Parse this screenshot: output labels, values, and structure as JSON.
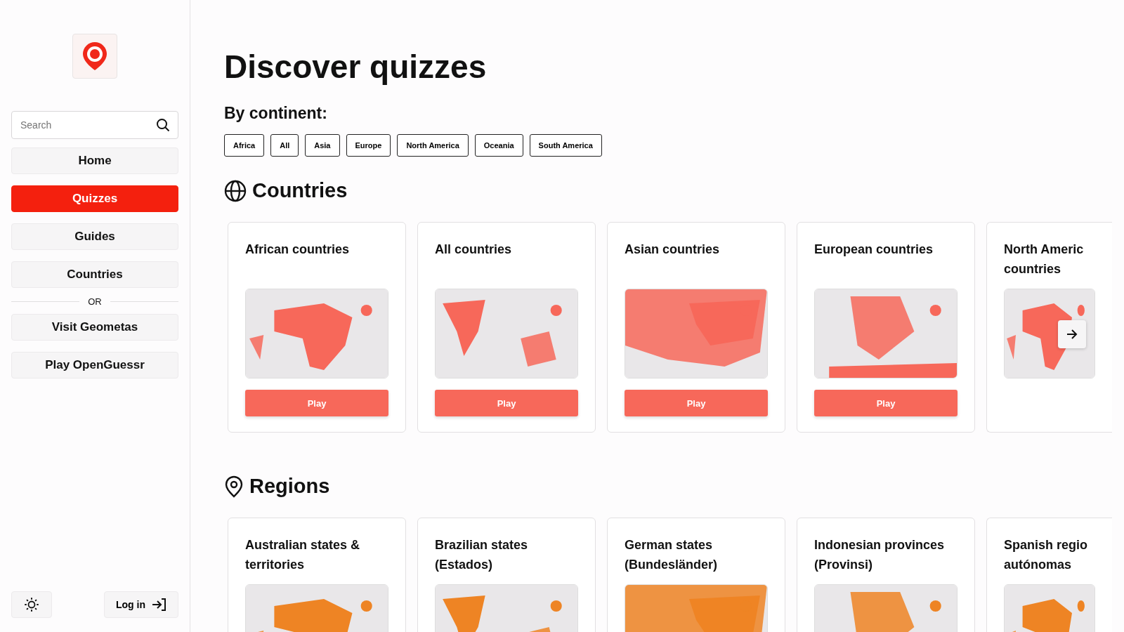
{
  "sidebar": {
    "search": {
      "placeholder": "Search"
    },
    "nav": [
      {
        "label": "Home",
        "selected": false
      },
      {
        "label": "Quizzes",
        "selected": true
      },
      {
        "label": "Guides",
        "selected": false
      },
      {
        "label": "Countries",
        "selected": false
      }
    ],
    "separator": "OR",
    "links": [
      "Visit Geometas",
      "Play OpenGuessr"
    ],
    "login": "Log in"
  },
  "title": "Discover quizzes",
  "filter_label": "By continent:",
  "filters": [
    "Africa",
    "All",
    "Asia",
    "Europe",
    "North America",
    "Oceania",
    "South America"
  ],
  "sections": [
    {
      "kind": "countries",
      "title": "Countries",
      "cards": [
        {
          "title": "African countries",
          "play": "Play"
        },
        {
          "title": "All countries",
          "play": "Play"
        },
        {
          "title": "Asian countries",
          "play": "Play"
        },
        {
          "title": "European countries",
          "play": "Play"
        },
        {
          "title": "North Americ countries",
          "partial": true
        }
      ]
    },
    {
      "kind": "regions",
      "title": "Regions",
      "cards": [
        {
          "title": "Australian states & territories"
        },
        {
          "title": "Brazilian states (Estados)"
        },
        {
          "title": "German states (Bundesländer)"
        },
        {
          "title": "Indonesian provinces (Provinsi)"
        },
        {
          "title": "Spanish regio autónomas",
          "partial": true
        }
      ]
    }
  ]
}
